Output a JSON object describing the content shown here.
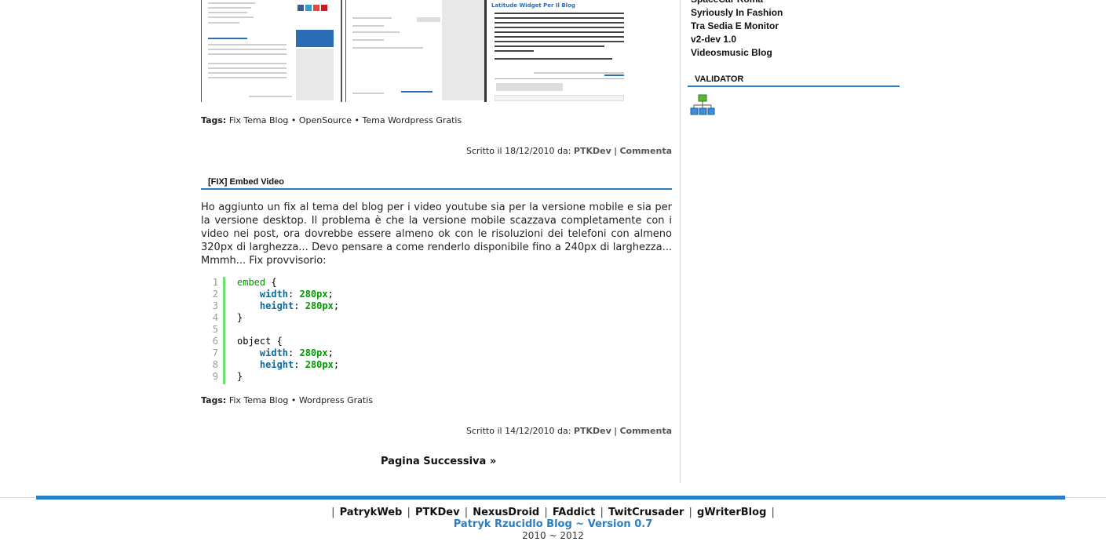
{
  "post_one": {
    "screenshot_caption": "Latitude Widget Per Il Blog",
    "tags_label": "Tags:",
    "tags": [
      "Fix Tema Blog",
      "OpenSource",
      "Tema Wordpress Gratis"
    ],
    "tag_separator": "•",
    "written_prefix": "Scritto il 18/12/2010 da:",
    "author": "PTKDev",
    "comments_label": "Commenta"
  },
  "post_two": {
    "title": "[FIX] Embed Video",
    "body": "Ho aggiunto un fix al tema del blog per i video youtube sia per la versione mobile e sia per la versione desktop. Il problema è che la versione mobile scazzava completamente con i video nei post, ora dovrebbe essere almeno ok con le risoluzioni dei telefoni con almeno 320px di larghezza... Devo pensare a come renderlo disponibile fino a 240px di larghezza... Mmmh... Fix provvisorio:",
    "code_line_numbers": [
      "1",
      "2",
      "3",
      "4",
      "5",
      "6",
      "7",
      "8",
      "9"
    ],
    "code": {
      "sel1": "embed",
      "open": "{",
      "close": "}",
      "prop_width": "width",
      "prop_height": "height",
      "value": "280px",
      "sel2": "object"
    },
    "tags_label": "Tags:",
    "tags": [
      "Fix Tema Blog",
      "Wordpress Gratis"
    ],
    "tag_separator": "•",
    "written_prefix": "Scritto il 14/12/2010 da:",
    "author": "PTKDev",
    "comments_label": "Commenta"
  },
  "pagination": {
    "next_label": "Pagina Successiva »"
  },
  "sidebar": {
    "blogroll": [
      "SpaceCar Roma",
      "Syriously In Fashion",
      "Tra Sedia E Monitor",
      "v2-dev 1.0",
      "Videosmusic Blog"
    ],
    "validator_title": "VALIDATOR",
    "validator_icon": "sitemap-icon"
  },
  "footer": {
    "links": [
      "PatrykWeb",
      "PTKDev",
      "NexusDroid",
      "FAddict",
      "TwitCrusader",
      "gWriterBlog"
    ],
    "separator": "|",
    "credit": "Patryk Rzucidlo Blog ~ Version 0.7",
    "years": "2010 ~ 2012"
  },
  "colors": {
    "accent": "#2a7fc4",
    "code_green": "#009900",
    "code_bar": "#6ce26c"
  }
}
